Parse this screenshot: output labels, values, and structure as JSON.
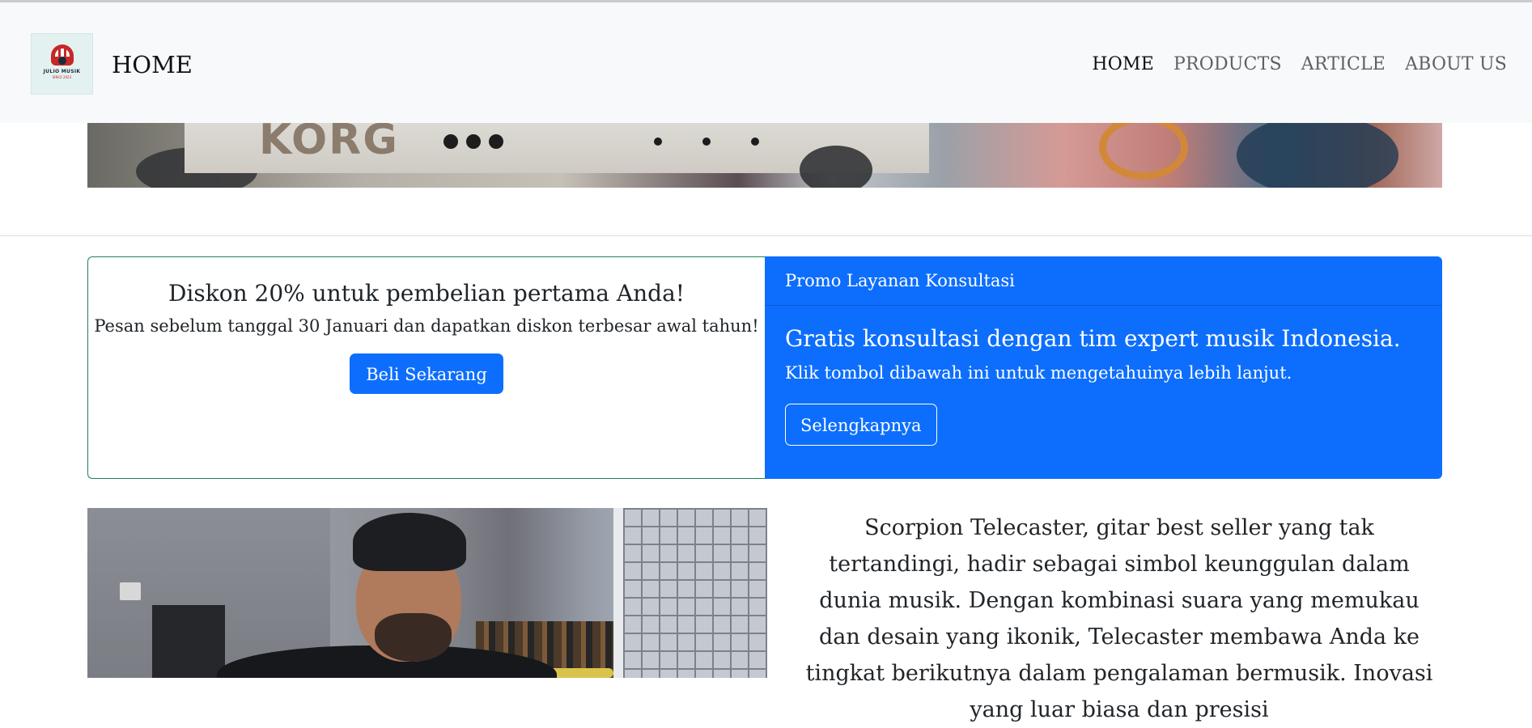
{
  "navbar": {
    "logo": {
      "text": "JULIO MUSIK",
      "subtext": "SINCE 2023",
      "icon": "julio-musik-logo"
    },
    "brand_label": "HOME",
    "links": [
      {
        "label": "HOME",
        "active": true
      },
      {
        "label": "PRODUCTS",
        "active": false
      },
      {
        "label": "ARTICLE",
        "active": false
      },
      {
        "label": "ABOUT US",
        "active": false
      }
    ]
  },
  "hero": {
    "image_subject": "korg-keyboard-banner",
    "visible_text": "KORG"
  },
  "promo_left": {
    "title": "Diskon 20% untuk pembelian pertama Anda!",
    "text": "Pesan sebelum tanggal 30 Januari dan dapatkan diskon terbesar awal tahun!",
    "button_label": "Beli Sekarang",
    "border_color": "#198754"
  },
  "promo_right": {
    "header": "Promo Layanan Konsultasi",
    "title": "Gratis konsultasi dengan tim expert musik Indonesia.",
    "text": "Klik tombol dibawah ini untuk mengetahuinya lebih lanjut.",
    "button_label": "Selengkapnya",
    "background_color": "#0d6efd"
  },
  "product": {
    "image_subject": "man-playing-guitar-photo",
    "description": "Scorpion Telecaster, gitar best seller yang tak tertandingi, hadir sebagai simbol keunggulan dalam dunia musik. Dengan kombinasi suara yang memukau dan desain yang ikonik, Telecaster membawa Anda ke tingkat berikutnya dalam pengalaman bermusik. Inovasi yang luar biasa dan presisi"
  }
}
